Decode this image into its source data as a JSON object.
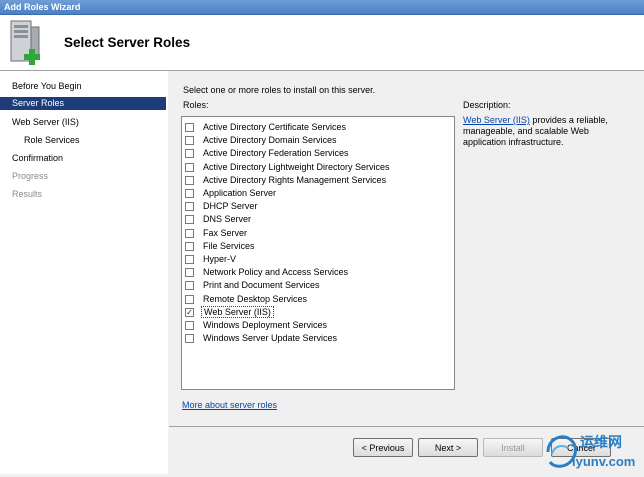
{
  "window": {
    "title": "Add Roles Wizard"
  },
  "header": {
    "title": "Select Server Roles"
  },
  "nav": {
    "items": [
      {
        "label": "Before You Begin",
        "state": "normal",
        "sub": false
      },
      {
        "label": "Server Roles",
        "state": "selected",
        "sub": false
      },
      {
        "label": "Web Server (IIS)",
        "state": "normal",
        "sub": false
      },
      {
        "label": "Role Services",
        "state": "normal",
        "sub": true
      },
      {
        "label": "Confirmation",
        "state": "normal",
        "sub": false
      },
      {
        "label": "Progress",
        "state": "disabled",
        "sub": false
      },
      {
        "label": "Results",
        "state": "disabled",
        "sub": false
      }
    ]
  },
  "main": {
    "instruction": "Select one or more roles to install on this server.",
    "roles_label": "Roles:",
    "description_label": "Description:",
    "description_link": "Web Server (IIS)",
    "description_text": " provides a reliable, manageable, and scalable Web application infrastructure.",
    "more_link": "More about server roles",
    "roles": [
      {
        "label": "Active Directory Certificate Services",
        "checked": false
      },
      {
        "label": "Active Directory Domain Services",
        "checked": false
      },
      {
        "label": "Active Directory Federation Services",
        "checked": false
      },
      {
        "label": "Active Directory Lightweight Directory Services",
        "checked": false
      },
      {
        "label": "Active Directory Rights Management Services",
        "checked": false
      },
      {
        "label": "Application Server",
        "checked": false
      },
      {
        "label": "DHCP Server",
        "checked": false
      },
      {
        "label": "DNS Server",
        "checked": false
      },
      {
        "label": "Fax Server",
        "checked": false
      },
      {
        "label": "File Services",
        "checked": false
      },
      {
        "label": "Hyper-V",
        "checked": false
      },
      {
        "label": "Network Policy and Access Services",
        "checked": false
      },
      {
        "label": "Print and Document Services",
        "checked": false
      },
      {
        "label": "Remote Desktop Services",
        "checked": false
      },
      {
        "label": "Web Server (IIS)",
        "checked": true,
        "selected": true
      },
      {
        "label": "Windows Deployment Services",
        "checked": false
      },
      {
        "label": "Windows Server Update Services",
        "checked": false
      }
    ]
  },
  "footer": {
    "previous": "< Previous",
    "next": "Next >",
    "install": "Install",
    "cancel": "Cancel"
  },
  "watermark": {
    "line1": "运维网",
    "line2": "iyunv.com"
  },
  "colors": {
    "nav_selected": "#1d3c78",
    "link": "#0645ad",
    "title_bar": "#4b7fc6"
  }
}
